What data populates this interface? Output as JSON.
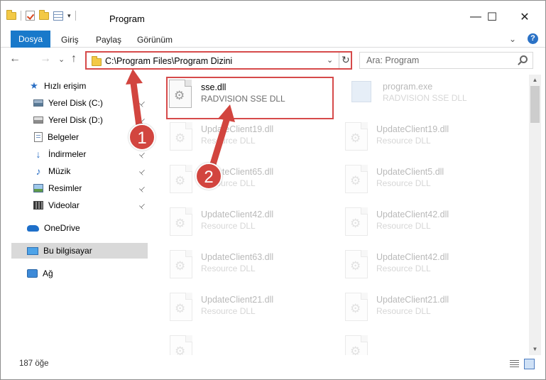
{
  "window": {
    "title": "Program",
    "minimize": "—",
    "maximize": "☐",
    "close": "✕"
  },
  "ribbon": {
    "tabs": [
      "Dosya",
      "Giriş",
      "Paylaş",
      "Görünüm"
    ],
    "expand": "⌄",
    "help": "?"
  },
  "nav": {
    "back": "←",
    "forward": "→",
    "recent": "⌄",
    "up": "↑",
    "address": "C:\\Program Files\\Program Dizini",
    "address_dropdown": "⌄",
    "refresh": "↻",
    "search_placeholder": "Ara: Program"
  },
  "sidebar": {
    "items": [
      {
        "label": "Hızlı erişim",
        "icon": "star-icon"
      },
      {
        "label": "Yerel Disk (C:)",
        "icon": "drive-icon",
        "pinned": true
      },
      {
        "label": "Yerel Disk (D:)",
        "icon": "drive-icon",
        "pinned": true
      },
      {
        "label": "Belgeler",
        "icon": "documents-icon",
        "pinned": true
      },
      {
        "label": "İndirmeler",
        "icon": "downloads-icon",
        "pinned": true
      },
      {
        "label": "Müzik",
        "icon": "music-icon",
        "pinned": true
      },
      {
        "label": "Resimler",
        "icon": "pictures-icon",
        "pinned": true
      },
      {
        "label": "Videolar",
        "icon": "videos-icon",
        "pinned": true
      },
      {
        "label": "OneDrive",
        "icon": "cloud-icon"
      },
      {
        "label": "Bu bilgisayar",
        "icon": "computer-icon",
        "selected": true
      },
      {
        "label": "Ağ",
        "icon": "network-icon"
      }
    ],
    "pin_glyph": "📌"
  },
  "files": [
    {
      "name": "sse.dll",
      "desc": "RADVISION SSE DLL",
      "highlighted": true
    },
    {
      "name": "program.exe",
      "desc": "RADVISION SSE DLL"
    },
    {
      "name": "UpdateClient19.dll",
      "desc": "Resource DLL"
    },
    {
      "name": "UpdateClient19.dll",
      "desc": "Resource DLL"
    },
    {
      "name": "UpdateClient65.dll",
      "desc": "Resource DLL"
    },
    {
      "name": "UpdateClient5.dll",
      "desc": "Resource DLL"
    },
    {
      "name": "UpdateClient42.dll",
      "desc": "Resource DLL"
    },
    {
      "name": "UpdateClient42.dll",
      "desc": "Resource DLL"
    },
    {
      "name": "UpdateClient63.dll",
      "desc": "Resource DLL"
    },
    {
      "name": "UpdateClient42.dll",
      "desc": "Resource DLL"
    },
    {
      "name": "UpdateClient21.dll",
      "desc": "Resource DLL"
    },
    {
      "name": "UpdateClient21.dll",
      "desc": "Resource DLL"
    }
  ],
  "status": {
    "item_count": "187 öğe"
  },
  "annotations": {
    "badge1": "1",
    "badge2": "2",
    "accent_color": "#d2453f"
  }
}
